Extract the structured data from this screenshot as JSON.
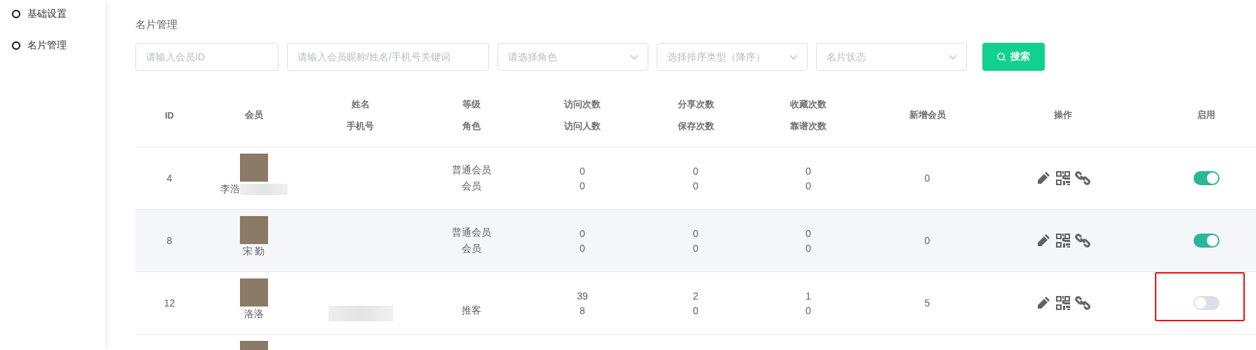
{
  "sidebar": {
    "items": [
      {
        "label": "基础设置",
        "selected": false
      },
      {
        "label": "名片管理",
        "selected": false
      }
    ]
  },
  "page_title": "名片管理",
  "filters": [
    {
      "kind": "input",
      "placeholder": "请输入会员ID"
    },
    {
      "kind": "input",
      "placeholder": "请输入会员昵称/姓名/手机号关键词"
    },
    {
      "kind": "select",
      "placeholder": "请选择角色"
    },
    {
      "kind": "select",
      "placeholder": "选择排序类型（降序）"
    },
    {
      "kind": "select",
      "placeholder": "名片状态"
    }
  ],
  "search_button": {
    "label": "搜索"
  },
  "table": {
    "columns": [
      [
        "ID"
      ],
      [
        "会员"
      ],
      [
        "姓名",
        "手机号"
      ],
      [
        "等级",
        "角色"
      ],
      [
        "访问次数",
        "访问人数"
      ],
      [
        "分享次数",
        "保存次数"
      ],
      [
        "收藏次数",
        "靠谱次数"
      ],
      [
        "新增会员"
      ],
      [
        "操作"
      ],
      [
        "启用"
      ]
    ],
    "rows": [
      {
        "kind": "full",
        "id": "4",
        "member": "李浩",
        "member_redacted": true,
        "phone_redacted": false,
        "level": "普通会员",
        "role": "会员",
        "visits": "0",
        "visitors": "0",
        "shares": "0",
        "saves": "0",
        "favorites": "0",
        "reliable": "0",
        "new_members": "0",
        "enabled": true,
        "annotated": false
      },
      {
        "kind": "full",
        "id": "8",
        "member": "宋 勤",
        "member_redacted": false,
        "phone_redacted": false,
        "level": "普通会员",
        "role": "会员",
        "visits": "0",
        "visitors": "0",
        "shares": "0",
        "saves": "0",
        "favorites": "0",
        "reliable": "0",
        "new_members": "0",
        "enabled": true,
        "annotated": false
      },
      {
        "kind": "full",
        "id": "12",
        "member": "洛洛",
        "member_redacted": false,
        "phone_redacted": true,
        "level": "",
        "role": "推客",
        "visits": "39",
        "visitors": "8",
        "shares": "2",
        "saves": "0",
        "favorites": "1",
        "reliable": "0",
        "new_members": "5",
        "enabled": false,
        "annotated": true
      },
      {
        "kind": "cut"
      }
    ]
  }
}
